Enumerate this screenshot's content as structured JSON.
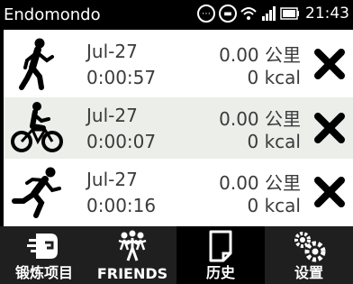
{
  "status_bar": {
    "app_name": "Endomondo",
    "time": "21:43",
    "icons": [
      "scroll-circle-icon",
      "message-circle-icon",
      "wifi-icon",
      "signal-icon",
      "battery-icon"
    ]
  },
  "workouts": [
    {
      "sport_icon": "walking-icon",
      "date": "Jul-27",
      "duration": "0:00:57",
      "distance": "0.00 公里",
      "calories": "0 kcal"
    },
    {
      "sport_icon": "cycling-icon",
      "date": "Jul-27",
      "duration": "0:00:07",
      "distance": "0.00 公里",
      "calories": "0 kcal"
    },
    {
      "sport_icon": "running-icon",
      "date": "Jul-27",
      "duration": "0:00:16",
      "distance": "0.00 公里",
      "calories": "0 kcal"
    }
  ],
  "tabs": [
    {
      "label": "锻炼项目",
      "icon": "workout-icon",
      "active": false
    },
    {
      "label": "FRIENDS",
      "icon": "friends-icon",
      "active": false
    },
    {
      "label": "历史",
      "icon": "history-icon",
      "active": true
    },
    {
      "label": "设置",
      "icon": "settings-icon",
      "active": false
    }
  ],
  "colors": {
    "accent": "#000000",
    "row_alt": "#eceeea",
    "tabbar": "#1f1f1f"
  }
}
